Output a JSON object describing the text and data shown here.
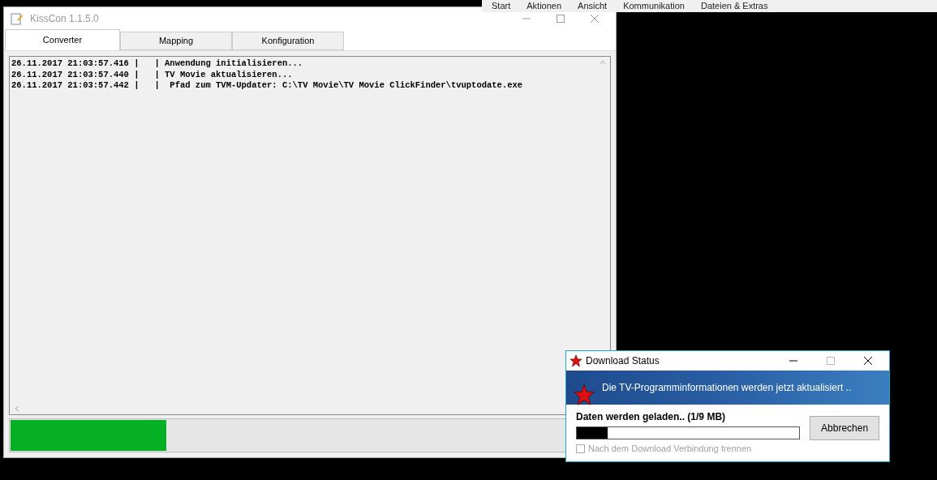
{
  "ribbon": {
    "items": [
      {
        "label": "Start"
      },
      {
        "label": "Aktionen"
      },
      {
        "label": "Ansicht"
      },
      {
        "label": "Kommunikation"
      },
      {
        "label": "Dateien & Extras"
      }
    ]
  },
  "main_window": {
    "title": "KissCon 1.1.5.0",
    "tabs": [
      {
        "label": "Converter",
        "selected": true
      },
      {
        "label": "Mapping",
        "selected": false
      },
      {
        "label": "Konfiguration",
        "selected": false
      }
    ],
    "log": [
      "26.11.2017 21:03:57.416 |   | Anwendung initialisieren...",
      "26.11.2017 21:03:57.440 |   | TV Movie aktualisieren...",
      "26.11.2017 21:03:57.442 |   |  Pfad zum TVM-Updater: C:\\TV Movie\\TV Movie ClickFinder\\tvuptodate.exe"
    ],
    "progress": {
      "level": 0.26
    }
  },
  "dialog": {
    "title": "Download Status",
    "banner": "Die TV-Programminformationen werden jetzt aktualisiert ..",
    "status": "Daten werden geladen.. (1/9 MB)",
    "progress": {
      "level": 0.14
    },
    "cancel_button": "Abbrechen",
    "disconnect_checkbox": {
      "label": "Nach dem Download Verbindung trennen",
      "checked": false,
      "disabled": true
    }
  }
}
